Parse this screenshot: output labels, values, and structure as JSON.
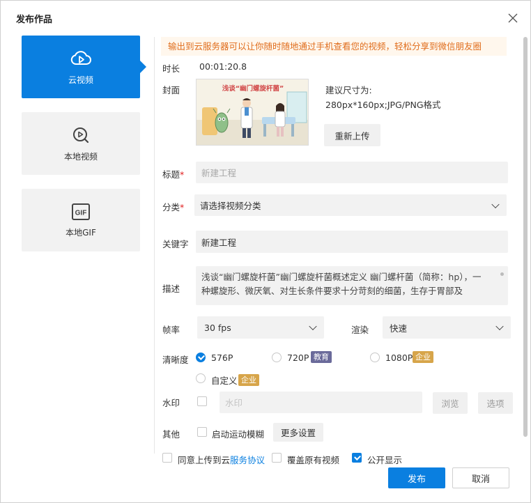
{
  "dialog": {
    "title": "发布作品"
  },
  "sidebar": {
    "items": [
      {
        "label": "云视频",
        "icon": "cloud-play-icon",
        "active": true
      },
      {
        "label": "本地视频",
        "icon": "video-search-icon",
        "active": false
      },
      {
        "label": "本地GIF",
        "icon": "gif-icon",
        "active": false
      }
    ]
  },
  "banner": "输出到云服务器可以让你随时随地通过手机查看您的视频，轻松分享到微信朋友圈",
  "form": {
    "duration_label": "时长",
    "duration_value": "00:01:20.8",
    "cover_label": "封面",
    "cover_image_text": "浅谈“幽门螺旋杆菌”",
    "cover_hint_line1": "建议尺寸为:",
    "cover_hint_line2": "280px*160px;JPG/PNG格式",
    "reupload_label": "重新上传",
    "title_label": "标题",
    "required_mark": "*",
    "title_placeholder": "新建工程",
    "category_label": "分类",
    "category_value": "请选择视频分类",
    "keyword_label": "关键字",
    "keyword_value": "新建工程",
    "desc_label": "描述",
    "desc_value": "浅谈“幽门螺旋杆菌”幽门螺旋杆菌概述定义        幽门螺杆菌（简称：hp），一种螺旋形、微厌氧、对生长条件要求十分苛刻的细菌，生存于胃部及",
    "fps_label": "帧率",
    "fps_value": "30 fps",
    "render_label": "渲染",
    "render_value": "快速",
    "resolution_label": "清晰度",
    "res_576": "576P",
    "res_720": "720P",
    "res_720_badge": "教育",
    "res_1080": "1080P",
    "res_1080_badge": "企业",
    "res_custom": "自定义",
    "res_custom_badge": "企业",
    "watermark_label": "水印",
    "watermark_placeholder": "水印",
    "browse_label": "浏览",
    "options_label": "选项",
    "other_label": "其他",
    "motion_blur_label": "启动运动模糊",
    "more_settings_label": "更多设置"
  },
  "footer": {
    "agree_prefix": "同意上传到云",
    "agree_link": "服务协议",
    "overwrite_label": "覆盖原有视频",
    "public_label": "公开显示",
    "publish_label": "发布",
    "cancel_label": "取消"
  },
  "colors": {
    "primary": "#0a7fe0",
    "banner_text": "#e06d1c",
    "banner_bg": "#fff7ed",
    "edu_badge": "#6a6a9a",
    "enterprise_badge": "#d7a54a"
  }
}
